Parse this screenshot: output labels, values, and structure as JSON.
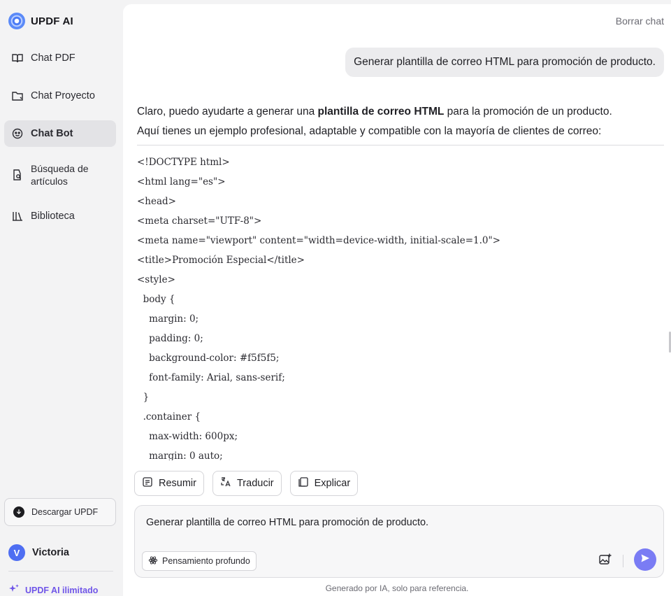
{
  "brand": {
    "name": "UPDF AI"
  },
  "sidebar": {
    "items": [
      {
        "label": "Chat PDF",
        "icon": "book-open-icon"
      },
      {
        "label": "Chat Proyecto",
        "icon": "folder-icon"
      },
      {
        "label": "Chat Bot",
        "icon": "bot-icon",
        "active": true
      },
      {
        "label": "Búsqueda de artículos",
        "icon": "document-search-icon"
      },
      {
        "label": "Biblioteca",
        "icon": "library-icon"
      }
    ],
    "download_label": "Descargar UPDF",
    "user": {
      "initial": "V",
      "name": "Victoria"
    },
    "upgrade_label": "UPDF AI ilimitado"
  },
  "header": {
    "clear_chat": "Borrar chat"
  },
  "conversation": {
    "user_message": "Generar plantilla de correo HTML para promoción de producto.",
    "answer": {
      "intro_before": "Claro, puedo ayudarte a generar una ",
      "intro_bold": "plantilla de correo HTML",
      "intro_after": " para la promoción de un producto.",
      "line2": "Aquí tienes un ejemplo profesional, adaptable y compatible con la mayoría de clientes de correo:"
    },
    "code_lines": [
      "<!DOCTYPE html>",
      "<html lang=\"es\">",
      "<head>",
      "<meta charset=\"UTF-8\">",
      "<meta name=\"viewport\" content=\"width=device-width, initial-scale=1.0\">",
      "<title>Promoción Especial</title>",
      "<style>",
      "  body {",
      "    margin: 0;",
      "    padding: 0;",
      "    background-color: #f5f5f5;",
      "    font-family: Arial, sans-serif;",
      "  }",
      "  .container {",
      "    max-width: 600px;",
      "    margin: 0 auto;"
    ]
  },
  "actions": {
    "summarize": "Resumir",
    "translate": "Traducir",
    "explain": "Explicar"
  },
  "composer": {
    "value": "Generar plantilla de correo HTML para promoción de producto.",
    "deep_thinking": "Pensamiento profundo"
  },
  "footer_note": "Generado por IA, solo para referencia.",
  "colors": {
    "accent": "#7a7cf4",
    "avatar": "#4e6ef2",
    "upgrade": "#6f55e8"
  }
}
